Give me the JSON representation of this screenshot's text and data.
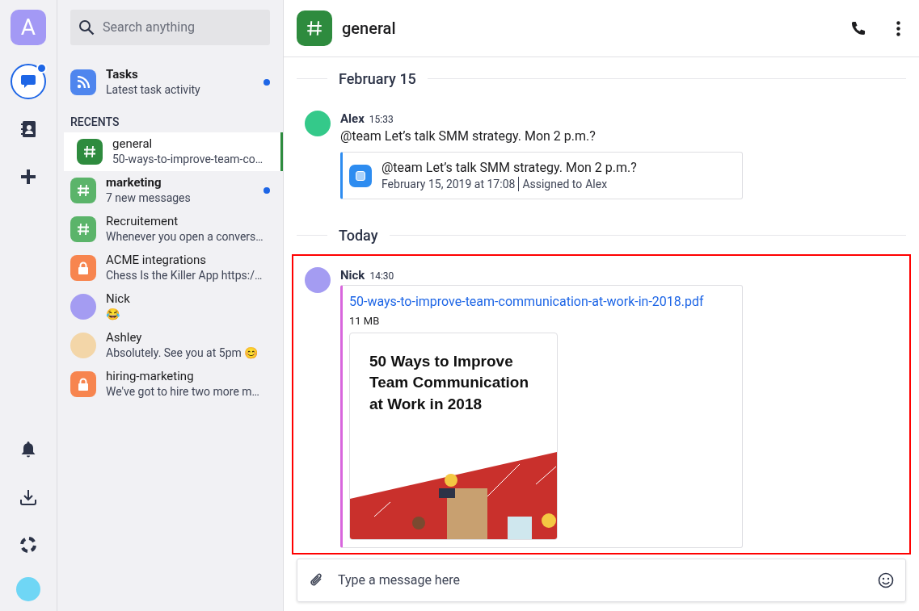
{
  "rail": {
    "account_letter": "A",
    "items": [
      {
        "kind": "chat",
        "selected": true,
        "unread": true
      },
      {
        "kind": "contacts",
        "selected": false,
        "unread": false
      },
      {
        "kind": "add",
        "selected": false,
        "unread": false
      }
    ],
    "bottom_items": [
      {
        "kind": "bell"
      },
      {
        "kind": "download"
      },
      {
        "kind": "help"
      },
      {
        "kind": "avatar",
        "color": "#6fd6f5"
      }
    ]
  },
  "sidebar": {
    "search": {
      "placeholder": "Search anything"
    },
    "pinned": {
      "title": "Tasks",
      "subtitle": "Latest task activity",
      "unread": true
    },
    "recents_heading": "RECENTS",
    "recents": [
      {
        "kind": "channel",
        "name": "general",
        "preview": "50-ways-to-improve-team-co…",
        "selected": true,
        "unread": false
      },
      {
        "kind": "channel",
        "name": "marketing",
        "preview": "7 new messages",
        "selected": false,
        "unread": true
      },
      {
        "kind": "channel",
        "name": "Recruitement",
        "preview": "Whenever you open a convers…",
        "selected": false,
        "unread": false
      },
      {
        "kind": "private",
        "name": "ACME integrations",
        "preview": "Chess Is the Killer App https:/…",
        "selected": false,
        "unread": false
      },
      {
        "kind": "direct",
        "name": "Nick",
        "preview": "😂",
        "selected": false,
        "unread": false,
        "color": "#a49cf2"
      },
      {
        "kind": "direct",
        "name": "Ashley",
        "preview": "Absolutely. See you at 5pm 😊",
        "selected": false,
        "unread": false,
        "color": "#f3d6a8"
      },
      {
        "kind": "private",
        "name": "hiring-marketing",
        "preview": "We've got to hire two more m…",
        "selected": false,
        "unread": false
      }
    ]
  },
  "channel": {
    "title": "general"
  },
  "days": [
    {
      "label": "February 15",
      "messages": [
        {
          "author": "Alex",
          "time": "15:33",
          "color": "#34c98a",
          "highlighted": false,
          "text": "@team Let’s talk SMM strategy. Mon 2 p.m.?",
          "attachment": {
            "kind": "task",
            "title": "@team Let’s talk SMM strategy. Mon 2 p.m.?",
            "date": "February 15, 2019 at 17:08",
            "assigned_label": "Assigned to",
            "assignee": "Alex"
          }
        }
      ]
    },
    {
      "label": "Today",
      "messages": [
        {
          "author": "Nick",
          "time": "14:30",
          "color": "#a49cf2",
          "highlighted": true,
          "attachment": {
            "kind": "file",
            "filename": "50-ways-to-improve-team-communication-at-work-in-2018.pdf",
            "size": "11 MB",
            "preview_title": "50 Ways to Improve Team Communication at Work in 2018"
          }
        }
      ]
    }
  ],
  "composer": {
    "placeholder": "Type a message here"
  }
}
